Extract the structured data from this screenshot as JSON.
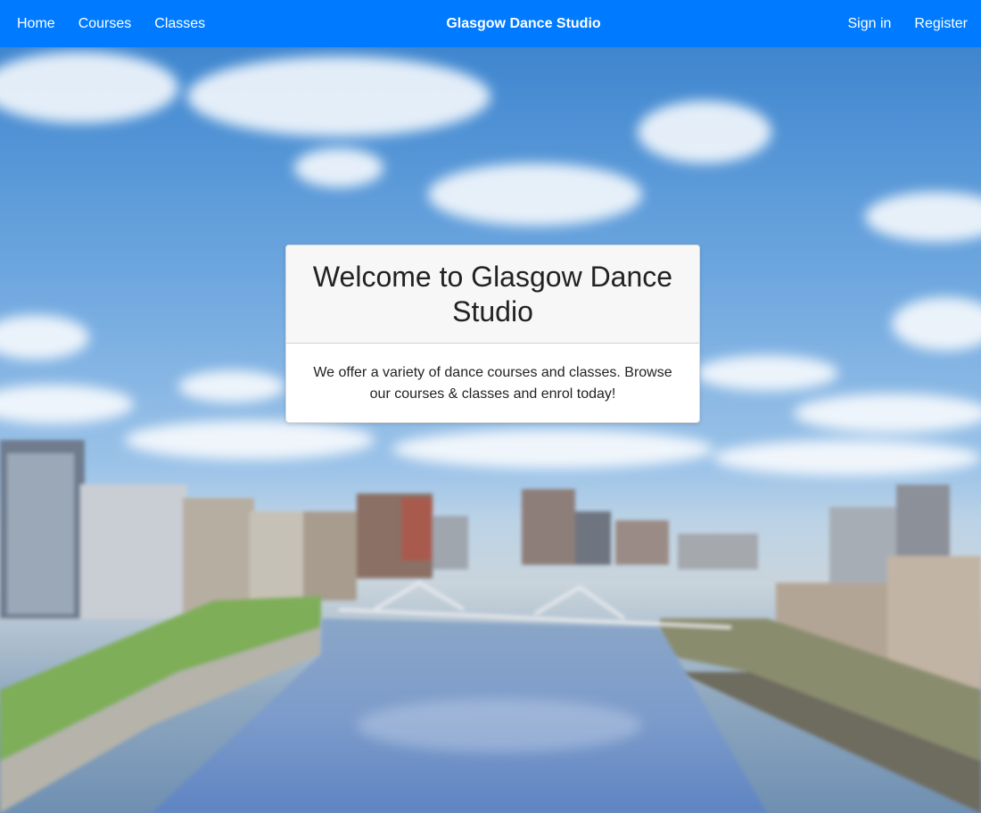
{
  "navbar": {
    "left_links": [
      "Home",
      "Courses",
      "Classes"
    ],
    "brand": "Glasgow Dance Studio",
    "right_links": [
      "Sign in",
      "Register"
    ],
    "background_color": "#007bff"
  },
  "hero": {
    "image_description_icon": "glasgow-river-clyde-cityscape-image"
  },
  "card": {
    "title": "Welcome to Glasgow Dance Studio",
    "text": "We offer a variety of dance courses and classes. Browse our courses & classes and enrol today!"
  }
}
